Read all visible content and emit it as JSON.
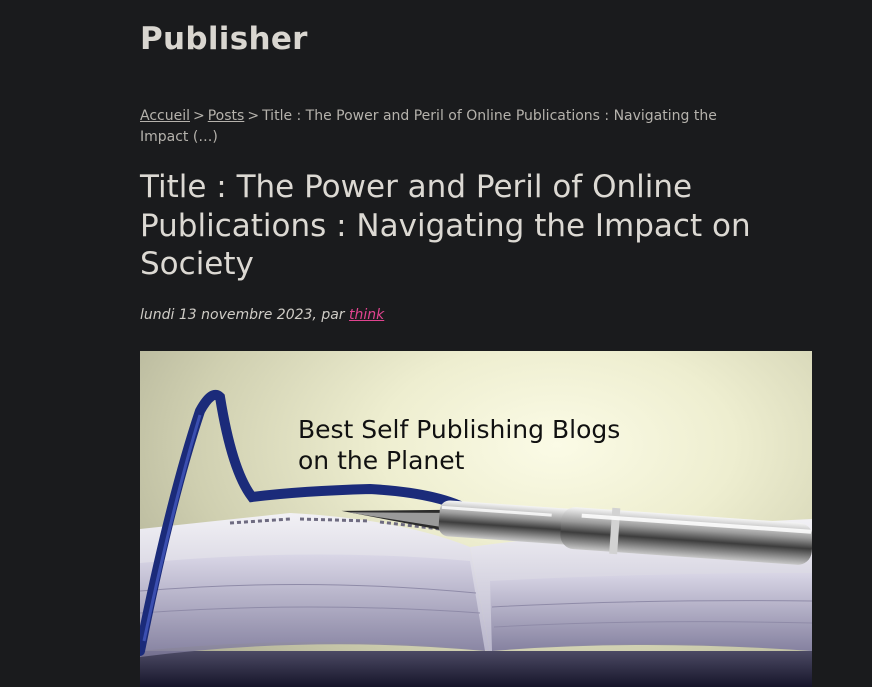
{
  "site": {
    "title": "Publisher"
  },
  "breadcrumb": {
    "home_label": "Accueil",
    "separator": ">",
    "posts_label": "Posts",
    "current_label": "Title : The Power and Peril of Online Publications : Navigating the Impact (…)"
  },
  "post": {
    "title": "Title : The Power and Peril of Online Publications : Navigating the Impact on Society",
    "date_prefix": "lundi 13 novembre 2023, par",
    "author": "think"
  },
  "hero": {
    "caption": "Best Self Publishing Blogs\non the Planet",
    "colors": {
      "ribbon": "#1b2b7a",
      "page": "#e6e4ee",
      "background": "#f4f4dc"
    }
  }
}
